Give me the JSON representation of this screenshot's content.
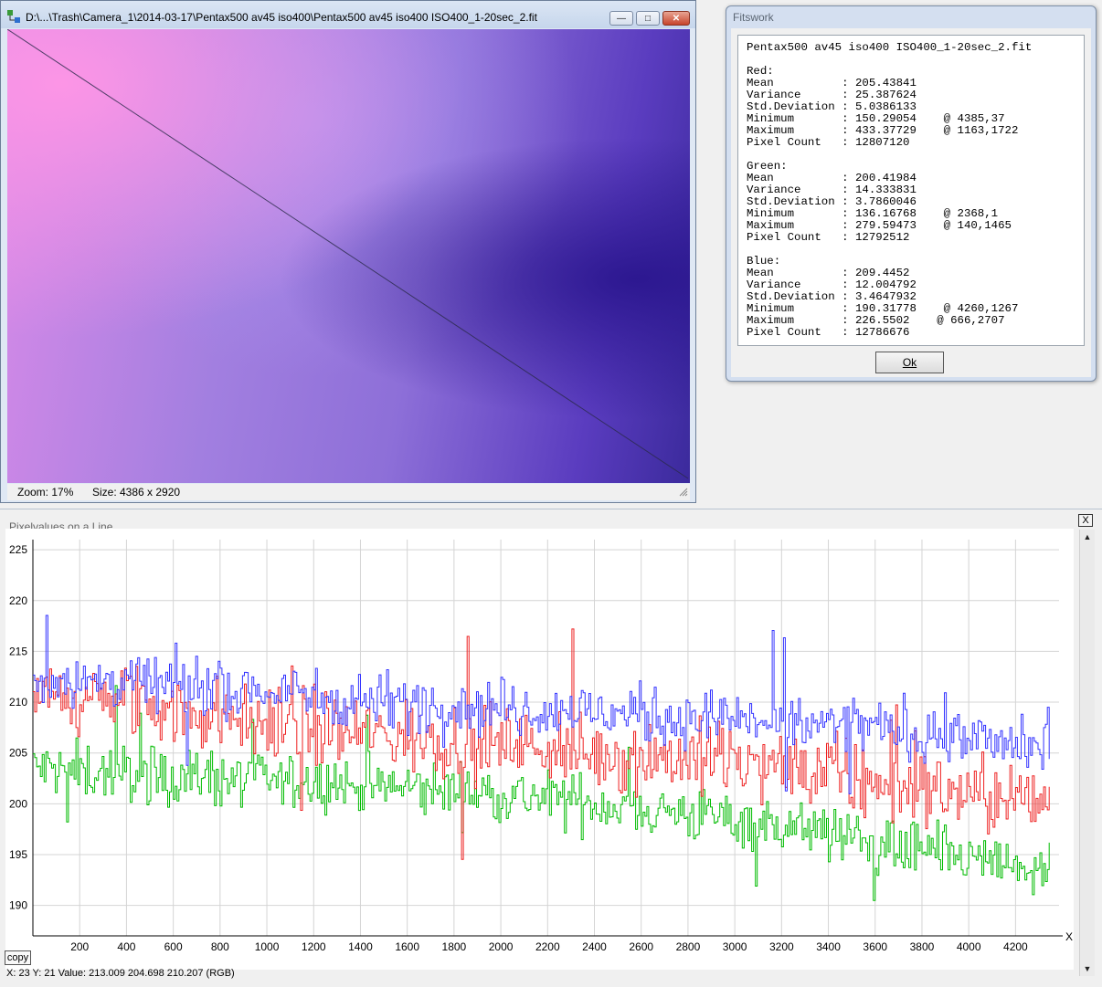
{
  "image_window": {
    "title": "D:\\...\\Trash\\Camera_1\\2014-03-17\\Pentax500 av45 iso400\\Pentax500 av45 iso400 ISO400_1-20sec_2.fit",
    "buttons": {
      "minimize": "minimize-icon",
      "maximize": "maximize-icon",
      "close": "close-icon"
    },
    "status": {
      "zoom": "Zoom: 17%",
      "size": "Size: 4386 x 2920"
    }
  },
  "stats_dialog": {
    "title": "Fitswork",
    "text": "Pentax500 av45 iso400 ISO400_1-20sec_2.fit\n\nRed:\nMean          : 205.43841\nVariance      : 25.387624\nStd.Deviation : 5.0386133\nMinimum       : 150.29054    @ 4385,37\nMaximum       : 433.37729    @ 1163,1722\nPixel Count   : 12807120\n\nGreen:\nMean          : 200.41984\nVariance      : 14.333831\nStd.Deviation : 3.7860046\nMinimum       : 136.16768    @ 2368,1\nMaximum       : 279.59473    @ 140,1465\nPixel Count   : 12792512\n\nBlue:\nMean          : 209.4452\nVariance      : 12.004792\nStd.Deviation : 3.4647932\nMinimum       : 190.31778    @ 4260,1267\nMaximum       : 226.5502    @ 666,2707\nPixel Count   : 12786676",
    "ok_label": "Ok"
  },
  "graph_window": {
    "title": "Pixelvalues on a Line",
    "close_label": "X",
    "copy_label": "copy",
    "readout": "X: 23  Y: 21  Value: 213.009  204.698  210.207 (RGB)"
  },
  "chart_data": {
    "type": "line",
    "x_axis_label": "X",
    "xlim": [
      0,
      4386
    ],
    "ylim": [
      187,
      226
    ],
    "x_ticks": [
      200,
      400,
      600,
      800,
      1000,
      1200,
      1400,
      1600,
      1800,
      2000,
      2200,
      2400,
      2600,
      2800,
      3000,
      3200,
      3400,
      3600,
      3800,
      4000,
      4200
    ],
    "y_ticks": [
      190,
      195,
      200,
      205,
      210,
      215,
      220,
      225
    ],
    "grid": true,
    "series": [
      {
        "color": "#3333ff",
        "x": [
          0,
          400,
          800,
          1200,
          1600,
          2000,
          2400,
          2800,
          3200,
          3600,
          4000,
          4350
        ],
        "values": [
          212.5,
          212,
          211.5,
          210.5,
          210,
          209.5,
          209,
          208.5,
          208,
          207.5,
          206.5,
          205
        ],
        "noise": 3.6
      },
      {
        "color": "#ee2222",
        "x": [
          0,
          400,
          800,
          1200,
          1600,
          2000,
          2400,
          2800,
          3200,
          3600,
          4000,
          4350
        ],
        "values": [
          210.5,
          210,
          208.5,
          207.5,
          206.5,
          206,
          205,
          204.5,
          203.5,
          202,
          201,
          200
        ],
        "noise": 4.8
      },
      {
        "color": "#00bb00",
        "x": [
          0,
          400,
          800,
          1200,
          1600,
          2000,
          2400,
          2800,
          3200,
          3600,
          4000,
          4350
        ],
        "values": [
          203.5,
          203,
          202.5,
          202,
          201.5,
          201,
          200,
          199,
          198,
          196,
          194.5,
          193
        ],
        "noise": 3.6
      }
    ]
  }
}
